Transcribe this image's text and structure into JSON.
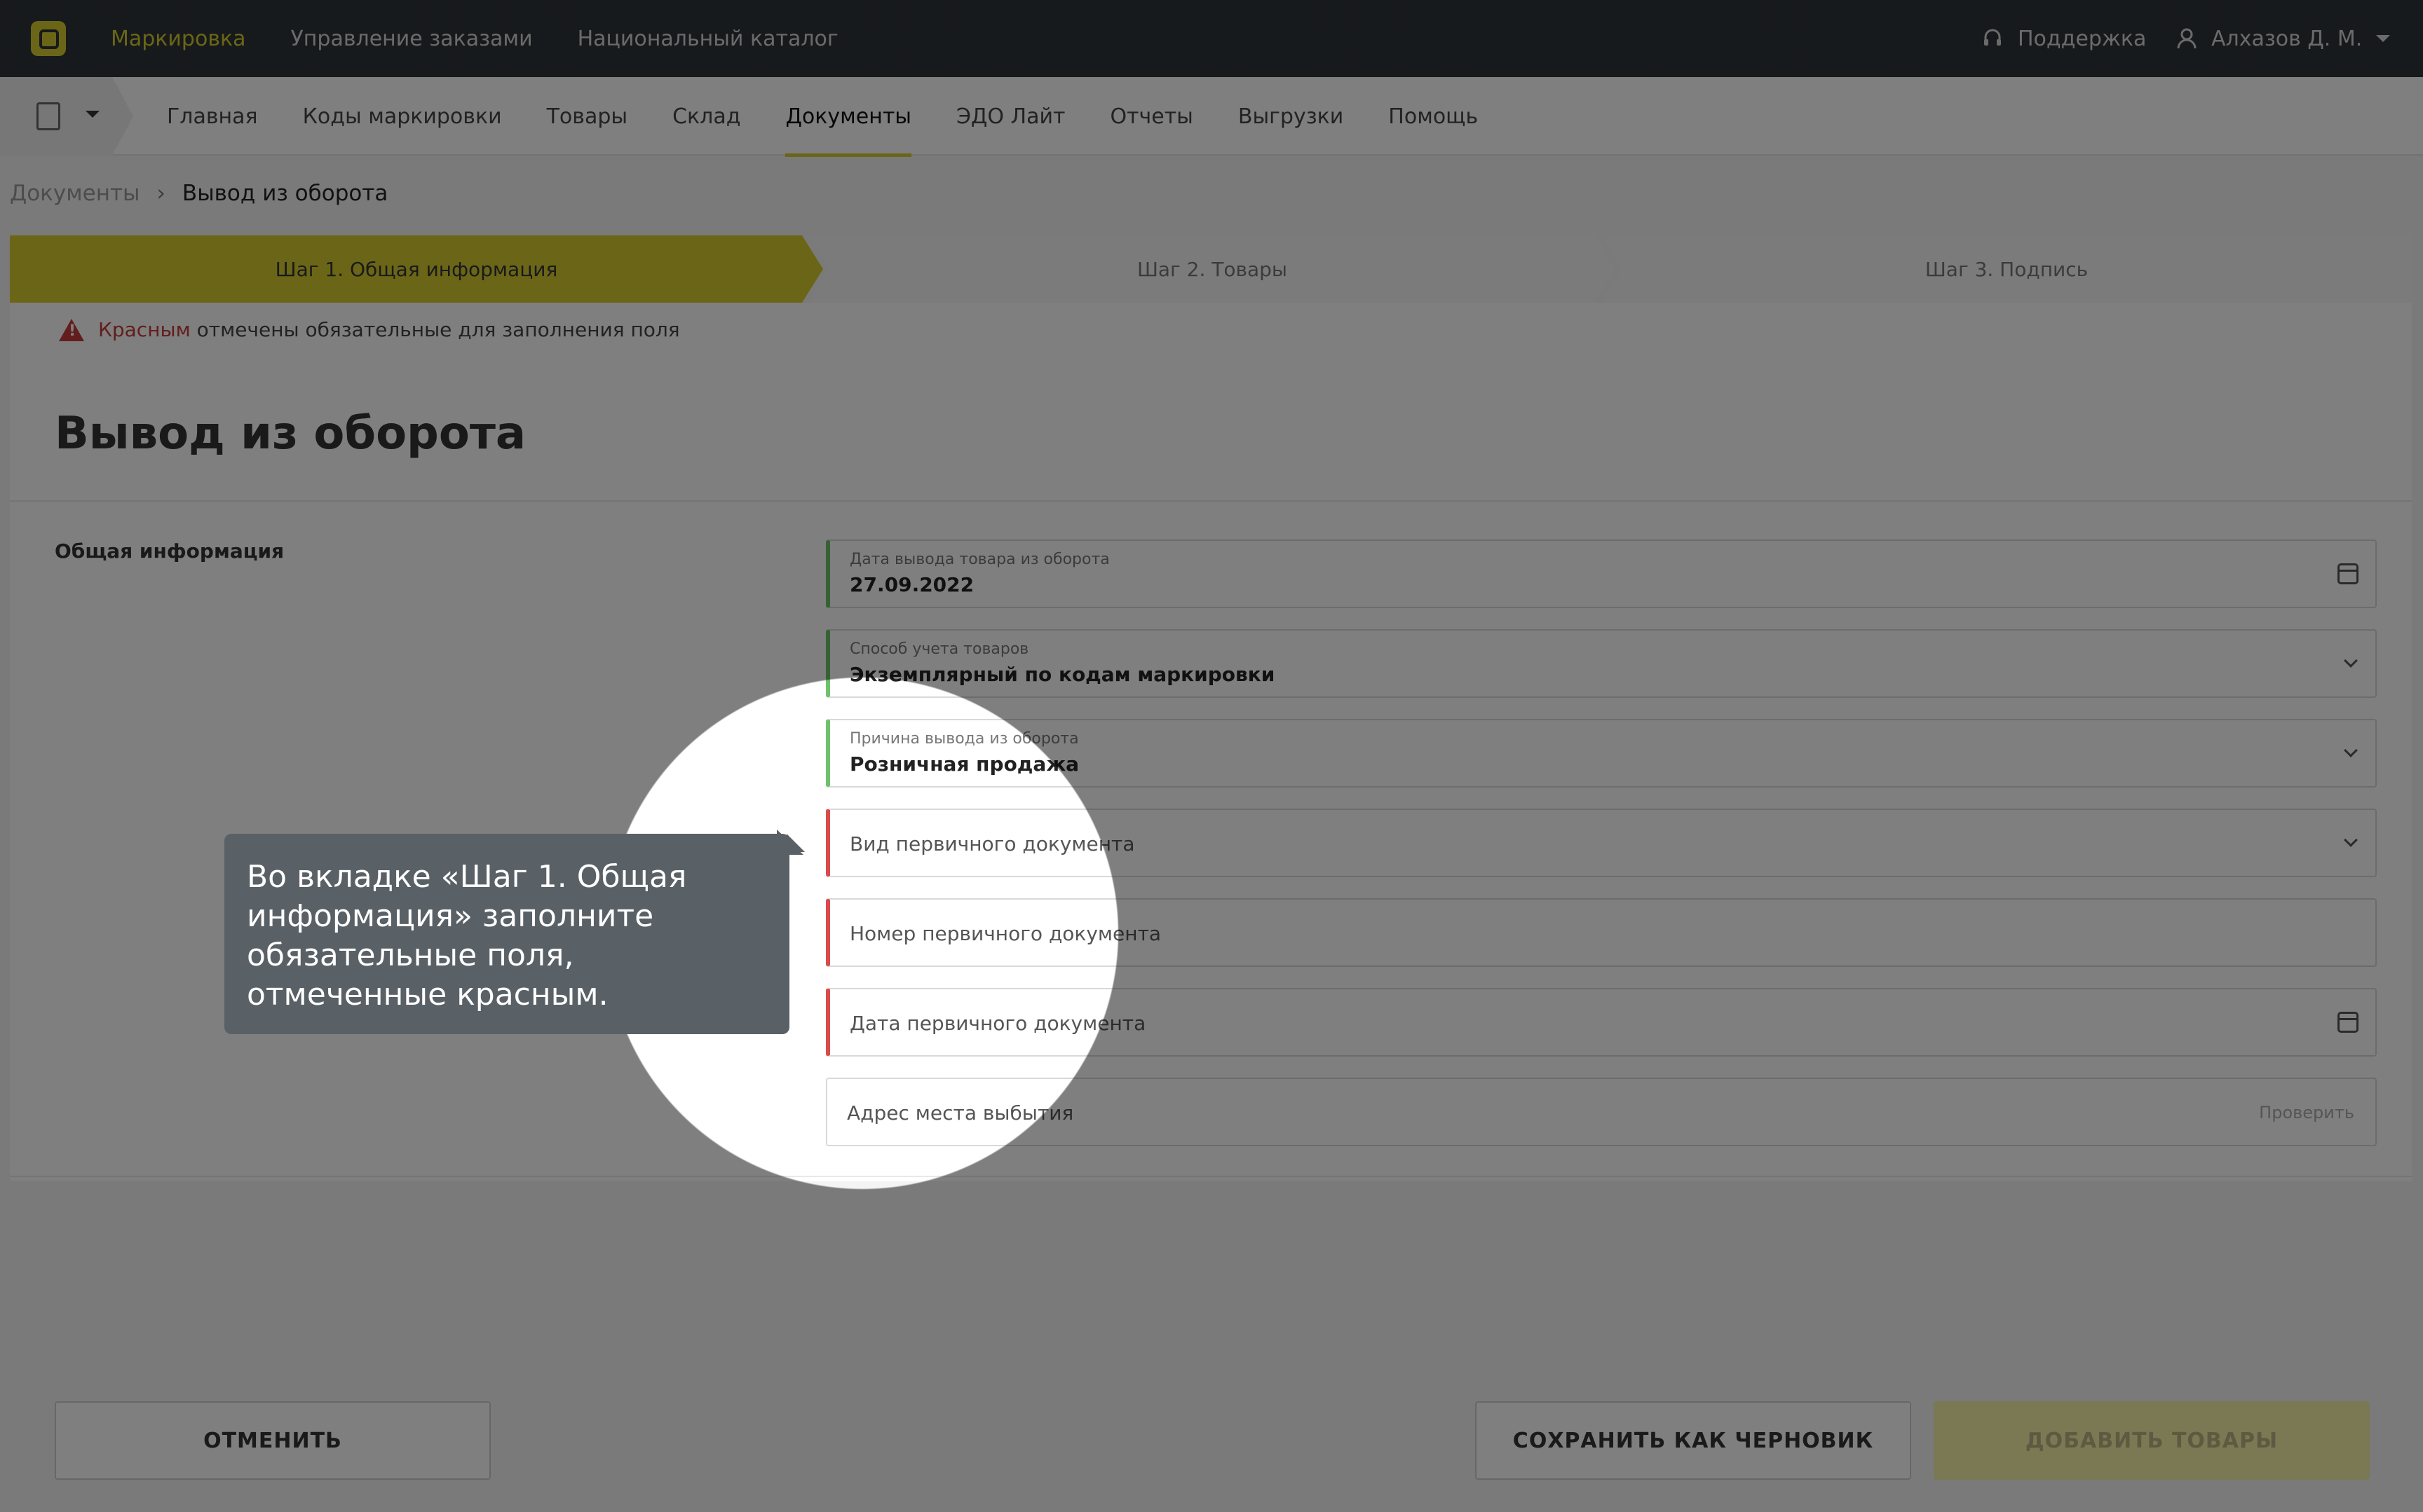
{
  "topbar": {
    "nav": [
      "Маркировка",
      "Управление заказами",
      "Национальный каталог"
    ],
    "support_label": "Поддержка",
    "user_name": "Алхазов Д. М."
  },
  "subnav": {
    "items": [
      "Главная",
      "Коды маркировки",
      "Товары",
      "Склад",
      "Документы",
      "ЭДО Лайт",
      "Отчеты",
      "Выгрузки",
      "Помощь"
    ],
    "active": "Документы"
  },
  "breadcrumb": {
    "parent": "Документы",
    "current": "Вывод из оборота"
  },
  "steps": [
    "Шаг 1. Общая информация",
    "Шаг 2. Товары",
    "Шаг 3. Подпись"
  ],
  "warning": {
    "red_word": "Красным",
    "rest": "отмечены обязательные для заполнения поля"
  },
  "page": {
    "title": "Вывод из оборота",
    "section_label": "Общая информация"
  },
  "fields": {
    "withdraw_date": {
      "label": "Дата вывода товара из оборота",
      "value": "27.09.2022"
    },
    "accounting_method": {
      "label": "Способ учета товаров",
      "value": "Экземплярный по кодам маркировки"
    },
    "reason": {
      "label": "Причина вывода из оборота",
      "value": "Розничная продажа"
    },
    "doc_type": {
      "placeholder": "Вид первичного документа"
    },
    "doc_number": {
      "placeholder": "Номер первичного документа"
    },
    "doc_date": {
      "placeholder": "Дата первичного документа"
    },
    "address": {
      "placeholder": "Адрес места выбытия",
      "check_label": "Проверить"
    }
  },
  "buttons": {
    "cancel": "ОТМЕНИТЬ",
    "save_draft": "СОХРАНИТЬ КАК ЧЕРНОВИК",
    "add_goods": "ДОБАВИТЬ ТОВАРЫ"
  },
  "tooltip": {
    "text": "Во вкладке «Шаг 1. Общая информация» заполните обязательные поля, отмеченные красным."
  },
  "colors": {
    "accent": "#d6cc2e",
    "required": "#d94b4b",
    "filled": "#6ec26b",
    "topbar": "#2e3338"
  }
}
